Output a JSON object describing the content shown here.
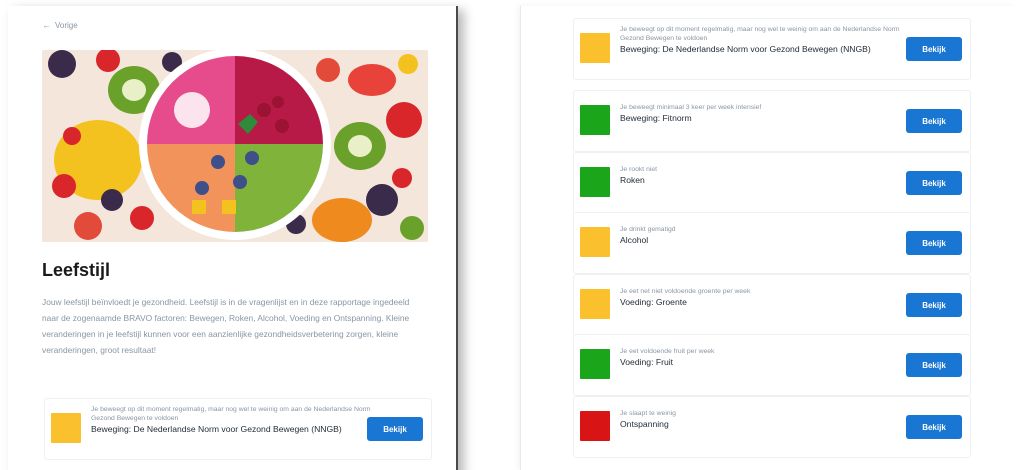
{
  "back_link": "Vorige",
  "title": "Leefstijl",
  "intro": "Jouw leefstijl beïnvloedt je gezondheid. Leefstijl is in de vragenlijst en in deze rapportage ingedeeld naar de zogenaamde BRAVO factoren: Bewegen, Roken, Alcohol, Voeding en Ontspanning. Kleine veranderingen in je leefstijl kunnen voor een aanzienlijke gezondheidsverbetering zorgen, kleine veranderingen, groot resultaat!",
  "button_label": "Bekijk",
  "colors": {
    "yellow": "#fbc02d",
    "green": "#1aa51a",
    "red": "#d81414",
    "primary": "#1976d2"
  },
  "left_card": {
    "color": "yellow",
    "desc": "Je beweegt op dit moment regelmatig, maar nog wel te weinig om aan de Nederlandse Norm Gezond Bewegen te voldoen",
    "title": "Beweging: De Nederlandse Norm voor Gezond Bewegen (NNGB)"
  },
  "cards": [
    {
      "color": "yellow",
      "desc": "Je beweegt op dit moment regelmatig, maar nog wel te weinig om aan de Nederlandse Norm Gezond Bewegen te voldoen",
      "title": "Beweging: De Nederlandse Norm voor Gezond Bewegen (NNGB)"
    },
    {
      "color": "green",
      "desc": "Je beweegt minimaal 3 keer per week intensief",
      "title": "Beweging: Fitnorm"
    },
    {
      "color": "green",
      "desc": "Je rookt niet",
      "title": "Roken"
    },
    {
      "color": "yellow",
      "desc": "Je drinkt gematigd",
      "title": "Alcohol"
    },
    {
      "color": "yellow",
      "desc": "Je eet net niet voldoende groente per week",
      "title": "Voeding: Groente"
    },
    {
      "color": "green",
      "desc": "Je eet voldoende fruit per week",
      "title": "Voeding: Fruit"
    },
    {
      "color": "red",
      "desc": "Je slaapt te weinig",
      "title": "Ontspanning"
    }
  ]
}
